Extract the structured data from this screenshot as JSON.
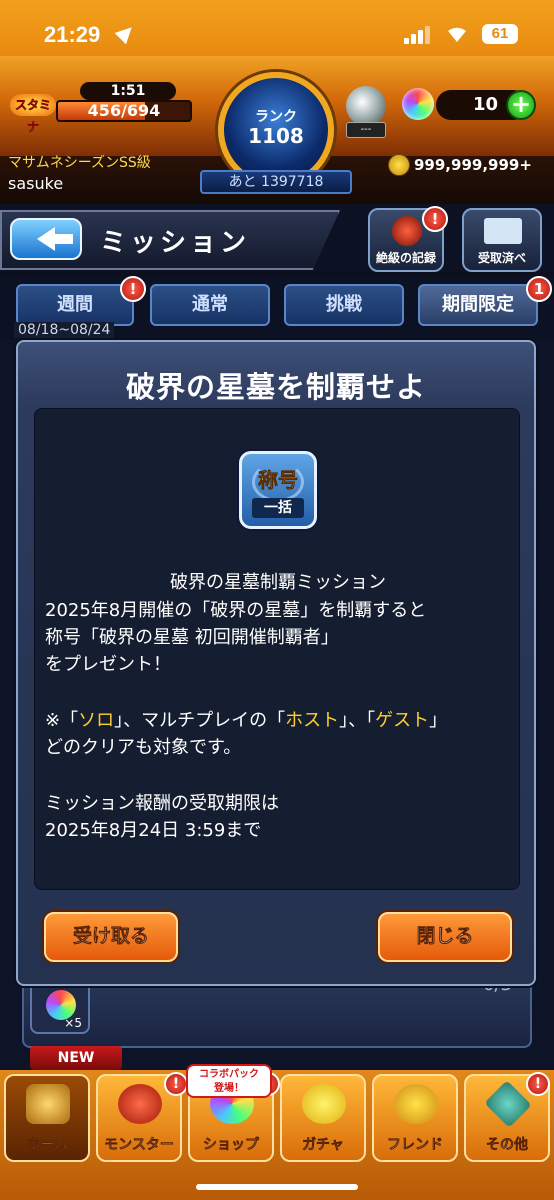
{
  "status_bar": {
    "time": "21:29",
    "battery": "61"
  },
  "header": {
    "stamina_label": "スタミナ",
    "stamina_timer": "1:51",
    "stamina_value": "456/694",
    "stamina_ratio": 0.657,
    "rank_label": "ランク",
    "rank_value": "1108",
    "rank_next": "あと 1397718",
    "player_title": "マサムネシーズンSS級",
    "player_name": "sasuke",
    "orb_pot_value": "---",
    "orb_count": "10",
    "orb_plus": "+",
    "coins": "999,999,999+"
  },
  "nav": {
    "title": "ミッション",
    "record_label": "絶級の記録",
    "record_badge": "!",
    "received_label": "受取済べ"
  },
  "tabs": [
    {
      "label": "週間",
      "badge": "!"
    },
    {
      "label": "通常",
      "badge": ""
    },
    {
      "label": "挑戦",
      "badge": ""
    },
    {
      "label": "期間限定",
      "badge": "1"
    }
  ],
  "tab_date": "08/18~08/24",
  "background": {
    "orb_count": "×5",
    "progress": "0/3",
    "new_tag": "NEW"
  },
  "modal": {
    "title": "破界の星墓を制覇せよ",
    "reward_title": "称号",
    "reward_sub": "一括",
    "line1": "破界の星墓制覇ミッション",
    "line2": "2025年8月開催の「破界の星墓」を制覇すると",
    "line3": "称号「破界の星墓 初回開催制覇者」",
    "line4": "をプレゼント！",
    "line5_a": "※「",
    "line5_solo": "ソロ",
    "line5_b": "」、マルチプレイの「",
    "line5_host": "ホスト",
    "line5_c": "」、「",
    "line5_guest": "ゲスト",
    "line5_d": "」",
    "line6": "どのクリアも対象です。",
    "line7": "ミッション報酬の受取期限は",
    "line8": "2025年8月24日 3:59まで",
    "receive_button": "受け取る",
    "close_button": "閉じる"
  },
  "bottom_nav": {
    "collab_tag_1": "コラボパック",
    "collab_tag_2": "登場！",
    "items": [
      {
        "label": "ホーム",
        "badge": ""
      },
      {
        "label": "モンスター",
        "badge": "!"
      },
      {
        "label": "ショップ",
        "badge": "!"
      },
      {
        "label": "ガチャ",
        "badge": ""
      },
      {
        "label": "フレンド",
        "badge": ""
      },
      {
        "label": "その他",
        "badge": "!"
      }
    ]
  },
  "colors": {
    "accent_orange": "#e88a10",
    "highlight_yellow": "#ffcf2a",
    "modal_blue": "#2c3a5c"
  }
}
